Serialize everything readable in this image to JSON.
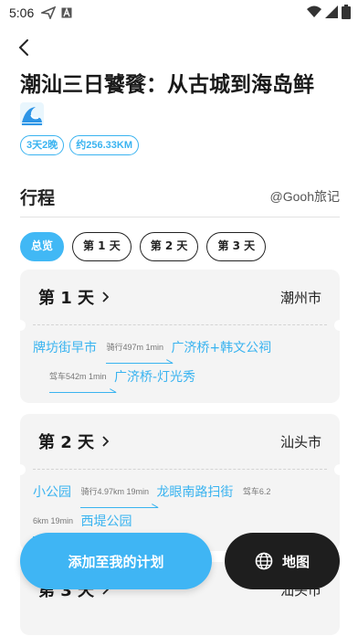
{
  "status": {
    "time": "5:06"
  },
  "title": "潮汕三日饕餮：从古城到海岛鲜",
  "chips": [
    "3天2晚",
    "约256.33KM"
  ],
  "section": {
    "title": "行程",
    "author": "@Gooh旅记"
  },
  "tabs": [
    "总览",
    "第 1 天",
    "第 2 天",
    "第 3 天"
  ],
  "days": [
    {
      "label": "第 1 天",
      "city": "潮州市",
      "stops": [
        "牌坊街早市",
        "广济桥+韩文公祠",
        "广济桥-灯光秀"
      ],
      "legs": [
        "骑行497m  1min",
        "驾车542m  1min"
      ]
    },
    {
      "label": "第 2 天",
      "city": "汕头市",
      "stops": [
        "小公园",
        "龙眼南路扫街",
        "西堤公园"
      ],
      "legs": [
        "骑行4.97km  19min",
        "驾车6.2",
        "6km  19min"
      ]
    },
    {
      "label": "第 3 天",
      "city": "汕头市"
    }
  ],
  "actions": {
    "add_plan": "添加至我的计划",
    "map": "地图"
  },
  "colors": {
    "accent": "#3fb5f4",
    "dark": "#1e1e1e"
  }
}
